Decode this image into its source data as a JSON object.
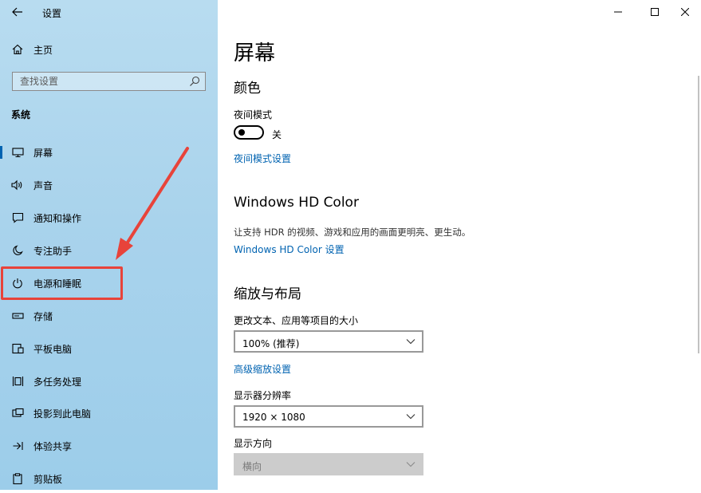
{
  "window": {
    "title": "设置",
    "controls": {
      "minimize": "minimize-icon",
      "maximize": "maximize-icon",
      "close": "close-icon"
    }
  },
  "sidebar": {
    "home_label": "主页",
    "search_placeholder": "查找设置",
    "section_title": "系统",
    "items": [
      {
        "label": "屏幕",
        "icon": "monitor-icon"
      },
      {
        "label": "声音",
        "icon": "speaker-icon"
      },
      {
        "label": "通知和操作",
        "icon": "notification-icon"
      },
      {
        "label": "专注助手",
        "icon": "moon-icon"
      },
      {
        "label": "电源和睡眠",
        "icon": "power-icon"
      },
      {
        "label": "存储",
        "icon": "storage-icon"
      },
      {
        "label": "平板电脑",
        "icon": "tablet-icon"
      },
      {
        "label": "多任务处理",
        "icon": "multitask-icon"
      },
      {
        "label": "投影到此电脑",
        "icon": "project-icon"
      },
      {
        "label": "体验共享",
        "icon": "share-icon"
      },
      {
        "label": "剪贴板",
        "icon": "clipboard-icon"
      }
    ],
    "active_index": 0
  },
  "main": {
    "page_title": "屏幕",
    "color": {
      "heading": "颜色",
      "night_mode_label": "夜间模式",
      "night_mode_state": "关",
      "night_mode_settings_link": "夜间模式设置"
    },
    "hd_color": {
      "heading": "Windows HD Color",
      "description": "让支持 HDR 的视频、游戏和应用的画面更明亮、更生动。",
      "settings_link": "Windows HD Color 设置"
    },
    "scale_layout": {
      "heading": "缩放与布局",
      "scale_label": "更改文本、应用等项目的大小",
      "scale_value": "100% (推荐)",
      "advanced_scale_link": "高级缩放设置",
      "resolution_label": "显示器分辨率",
      "resolution_value": "1920 × 1080",
      "orientation_label": "显示方向",
      "orientation_value": "横向"
    }
  },
  "colors": {
    "accent": "#0063b1",
    "annotation": "#e8433a",
    "sidebar_bg": "#a9d3ec"
  }
}
